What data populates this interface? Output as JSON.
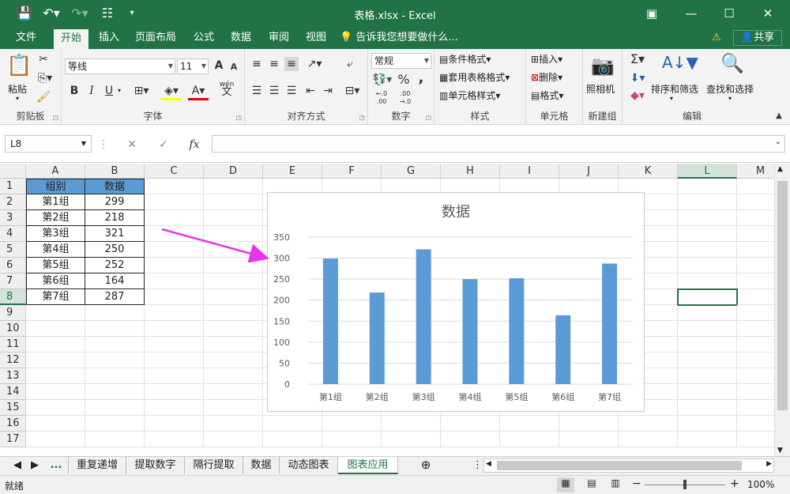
{
  "window": {
    "title": "表格.xlsx - Excel",
    "ribbon_display_icon": "ribbon-display-icon",
    "minimize_icon": "minimize-icon",
    "maximize_icon": "maximize-icon",
    "close_icon": "close-icon"
  },
  "tabs": [
    "文件",
    "开始",
    "插入",
    "页面布局",
    "公式",
    "数据",
    "审阅",
    "视图"
  ],
  "active_tab": "开始",
  "tell_me": "告诉我您想要做什么...",
  "share": "共享",
  "ribbon": {
    "clipboard": {
      "paste": "粘贴",
      "label": "剪贴板"
    },
    "font": {
      "name": "等线",
      "size": "11",
      "label": "字体",
      "bold": "B",
      "italic": "I",
      "underline": "U",
      "grow": "A",
      "shrink": "A",
      "color": "A",
      "wen": "wén",
      "wen2": "文"
    },
    "alignment": {
      "label": "对齐方式"
    },
    "number": {
      "format": "常规",
      "label": "数字",
      "percent": "%",
      "comma": ","
    },
    "styles": {
      "conditional": "条件格式",
      "table": "套用表格格式",
      "cell": "单元格样式",
      "label": "样式"
    },
    "cells": {
      "insert": "插入",
      "delete": "删除",
      "format": "格式",
      "label": "单元格"
    },
    "camera": {
      "label": "照相机",
      "group": "新建组"
    },
    "editing": {
      "sort": "排序和筛选",
      "find": "查找和选择",
      "label": "编辑"
    }
  },
  "formula_bar": {
    "name_box": "L8",
    "fx": "fx",
    "cancel": "✕",
    "enter": "✓",
    "content": ""
  },
  "columns": [
    "A",
    "B",
    "C",
    "D",
    "E",
    "F",
    "G",
    "H",
    "I",
    "J",
    "K",
    "L",
    "M"
  ],
  "rows": [
    "1",
    "2",
    "3",
    "4",
    "5",
    "6",
    "7",
    "8",
    "9",
    "10",
    "11",
    "12",
    "13",
    "14",
    "15",
    "16",
    "17"
  ],
  "selected_cell": "L8",
  "table": {
    "headers": [
      "组别",
      "数据"
    ],
    "rows": [
      [
        "第1组",
        "299"
      ],
      [
        "第2组",
        "218"
      ],
      [
        "第3组",
        "321"
      ],
      [
        "第4组",
        "250"
      ],
      [
        "第5组",
        "252"
      ],
      [
        "第6组",
        "164"
      ],
      [
        "第7组",
        "287"
      ]
    ]
  },
  "chart_data": {
    "type": "bar",
    "title": "数据",
    "categories": [
      "第1组",
      "第2组",
      "第3组",
      "第4组",
      "第5组",
      "第6组",
      "第7组"
    ],
    "values": [
      299,
      218,
      321,
      250,
      252,
      164,
      287
    ],
    "ylim": [
      0,
      350
    ],
    "yticks": [
      "0",
      "50",
      "100",
      "150",
      "200",
      "250",
      "300",
      "350"
    ],
    "grid": true,
    "bar_color": "#5b9bd5"
  },
  "annotation_color": "#e833e8",
  "sheet_tabs": [
    "...",
    "重复递增",
    "提取数字",
    "隔行提取",
    "数据",
    "动态图表",
    "图表应用"
  ],
  "active_sheet": "图表应用",
  "status": {
    "mode": "就绪",
    "zoom": "100%"
  },
  "colors": {
    "brand": "#217346",
    "header_fill": "#5b9bd5"
  }
}
